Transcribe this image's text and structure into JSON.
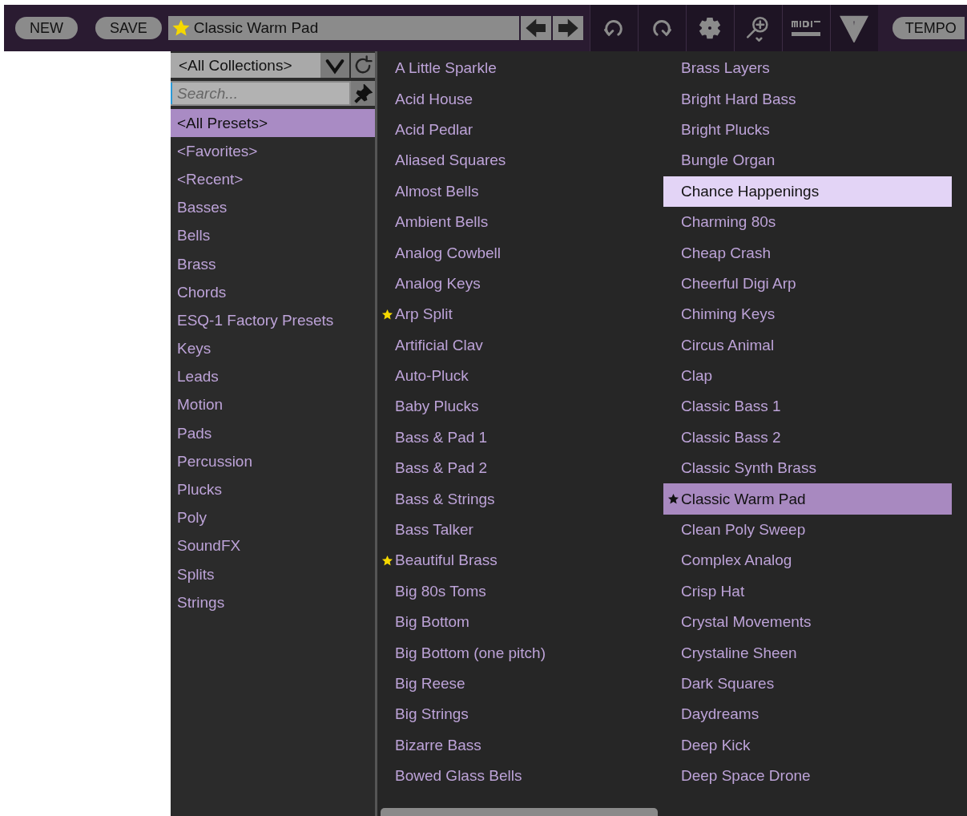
{
  "toolbar": {
    "new_label": "NEW",
    "save_label": "SAVE",
    "preset_name": "Classic Warm Pad",
    "preset_favorite": true,
    "tempo_label": "TEMPO"
  },
  "browser": {
    "collection": "<All Collections>",
    "search_placeholder": "Search...",
    "categories": [
      {
        "label": "<All Presets>",
        "selected": true
      },
      {
        "label": "<Favorites>",
        "selected": false
      },
      {
        "label": "<Recent>",
        "selected": false
      },
      {
        "label": "Basses",
        "selected": false
      },
      {
        "label": "Bells",
        "selected": false
      },
      {
        "label": "Brass",
        "selected": false
      },
      {
        "label": "Chords",
        "selected": false
      },
      {
        "label": "ESQ-1 Factory Presets",
        "selected": false
      },
      {
        "label": "Keys",
        "selected": false
      },
      {
        "label": "Leads",
        "selected": false
      },
      {
        "label": "Motion",
        "selected": false
      },
      {
        "label": "Pads",
        "selected": false
      },
      {
        "label": "Percussion",
        "selected": false
      },
      {
        "label": "Plucks",
        "selected": false
      },
      {
        "label": "Poly",
        "selected": false
      },
      {
        "label": "SoundFX",
        "selected": false
      },
      {
        "label": "Splits",
        "selected": false
      },
      {
        "label": "Strings",
        "selected": false
      }
    ],
    "preset_columns": [
      [
        {
          "name": "A Little Sparkle",
          "favorite": false,
          "selected": false,
          "hovered": false
        },
        {
          "name": "Acid House",
          "favorite": false,
          "selected": false,
          "hovered": false
        },
        {
          "name": "Acid Pedlar",
          "favorite": false,
          "selected": false,
          "hovered": false
        },
        {
          "name": "Aliased Squares",
          "favorite": false,
          "selected": false,
          "hovered": false
        },
        {
          "name": "Almost Bells",
          "favorite": false,
          "selected": false,
          "hovered": false
        },
        {
          "name": "Ambient Bells",
          "favorite": false,
          "selected": false,
          "hovered": false
        },
        {
          "name": "Analog Cowbell",
          "favorite": false,
          "selected": false,
          "hovered": false
        },
        {
          "name": "Analog Keys",
          "favorite": false,
          "selected": false,
          "hovered": false
        },
        {
          "name": "Arp Split",
          "favorite": true,
          "selected": false,
          "hovered": false
        },
        {
          "name": "Artificial Clav",
          "favorite": false,
          "selected": false,
          "hovered": false
        },
        {
          "name": "Auto-Pluck",
          "favorite": false,
          "selected": false,
          "hovered": false
        },
        {
          "name": "Baby Plucks",
          "favorite": false,
          "selected": false,
          "hovered": false
        },
        {
          "name": "Bass & Pad 1",
          "favorite": false,
          "selected": false,
          "hovered": false
        },
        {
          "name": "Bass & Pad 2",
          "favorite": false,
          "selected": false,
          "hovered": false
        },
        {
          "name": "Bass & Strings",
          "favorite": false,
          "selected": false,
          "hovered": false
        },
        {
          "name": "Bass Talker",
          "favorite": false,
          "selected": false,
          "hovered": false
        },
        {
          "name": "Beautiful Brass",
          "favorite": true,
          "selected": false,
          "hovered": false
        },
        {
          "name": "Big 80s Toms",
          "favorite": false,
          "selected": false,
          "hovered": false
        },
        {
          "name": "Big Bottom",
          "favorite": false,
          "selected": false,
          "hovered": false
        },
        {
          "name": "Big Bottom (one pitch)",
          "favorite": false,
          "selected": false,
          "hovered": false
        },
        {
          "name": "Big Reese",
          "favorite": false,
          "selected": false,
          "hovered": false
        },
        {
          "name": "Big Strings",
          "favorite": false,
          "selected": false,
          "hovered": false
        },
        {
          "name": "Bizarre Bass",
          "favorite": false,
          "selected": false,
          "hovered": false
        },
        {
          "name": "Bowed Glass Bells",
          "favorite": false,
          "selected": false,
          "hovered": false
        }
      ],
      [
        {
          "name": "Brass Layers",
          "favorite": false,
          "selected": false,
          "hovered": false
        },
        {
          "name": "Bright Hard Bass",
          "favorite": false,
          "selected": false,
          "hovered": false
        },
        {
          "name": "Bright Plucks",
          "favorite": false,
          "selected": false,
          "hovered": false
        },
        {
          "name": "Bungle Organ",
          "favorite": false,
          "selected": false,
          "hovered": false
        },
        {
          "name": "Chance Happenings",
          "favorite": false,
          "selected": false,
          "hovered": true
        },
        {
          "name": "Charming 80s",
          "favorite": false,
          "selected": false,
          "hovered": false
        },
        {
          "name": "Cheap Crash",
          "favorite": false,
          "selected": false,
          "hovered": false
        },
        {
          "name": "Cheerful Digi Arp",
          "favorite": false,
          "selected": false,
          "hovered": false
        },
        {
          "name": "Chiming Keys",
          "favorite": false,
          "selected": false,
          "hovered": false
        },
        {
          "name": "Circus Animal",
          "favorite": false,
          "selected": false,
          "hovered": false
        },
        {
          "name": "Clap",
          "favorite": false,
          "selected": false,
          "hovered": false
        },
        {
          "name": "Classic Bass 1",
          "favorite": false,
          "selected": false,
          "hovered": false
        },
        {
          "name": "Classic Bass 2",
          "favorite": false,
          "selected": false,
          "hovered": false
        },
        {
          "name": "Classic Synth Brass",
          "favorite": false,
          "selected": false,
          "hovered": false
        },
        {
          "name": "Classic Warm Pad",
          "favorite": true,
          "selected": true,
          "hovered": false
        },
        {
          "name": "Clean Poly Sweep",
          "favorite": false,
          "selected": false,
          "hovered": false
        },
        {
          "name": "Complex Analog",
          "favorite": false,
          "selected": false,
          "hovered": false
        },
        {
          "name": "Crisp Hat",
          "favorite": false,
          "selected": false,
          "hovered": false
        },
        {
          "name": "Crystal Movements",
          "favorite": false,
          "selected": false,
          "hovered": false
        },
        {
          "name": "Crystaline Sheen",
          "favorite": false,
          "selected": false,
          "hovered": false
        },
        {
          "name": "Dark Squares",
          "favorite": false,
          "selected": false,
          "hovered": false
        },
        {
          "name": "Daydreams",
          "favorite": false,
          "selected": false,
          "hovered": false
        },
        {
          "name": "Deep Kick",
          "favorite": false,
          "selected": false,
          "hovered": false
        },
        {
          "name": "Deep Space Drone",
          "favorite": false,
          "selected": false,
          "hovered": false
        }
      ]
    ]
  }
}
